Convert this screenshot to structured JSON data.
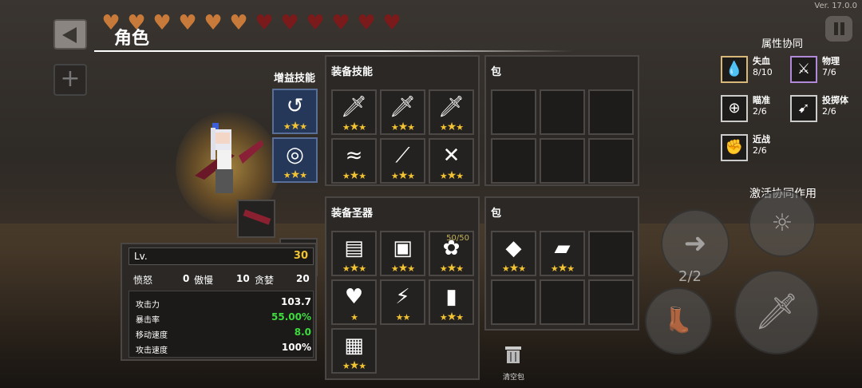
{
  "version": "Ver. 17.0.0",
  "title": "角色",
  "hearts": {
    "full": 6,
    "empty": 6
  },
  "colors": {
    "star": "#f1c232",
    "green": "#3ddc3d",
    "gold_lv": "#f1c232",
    "heart_full": "#c87a3a",
    "heart_empty": "#7a1a1a"
  },
  "buff_skills": {
    "label": "增益技能",
    "items": [
      {
        "icon": "swirl-icon",
        "glyph": "↺",
        "stars": 3
      },
      {
        "icon": "vortex-orb-icon",
        "glyph": "◎",
        "stars": 3
      }
    ]
  },
  "equip_skills": {
    "label": "装备技能",
    "items": [
      {
        "icon": "sword-slash-icon",
        "glyph": "🗡",
        "stars": 3
      },
      {
        "icon": "sword-slash-icon",
        "glyph": "🗡",
        "stars": 3
      },
      {
        "icon": "sword-slash-icon",
        "glyph": "🗡",
        "stars": 3
      },
      {
        "icon": "whirlwind-icon",
        "glyph": "≈",
        "stars": 3
      },
      {
        "icon": "feather-slash-icon",
        "glyph": "⟋",
        "stars": 3
      },
      {
        "icon": "cross-slash-icon",
        "glyph": "✕",
        "stars": 3
      }
    ]
  },
  "skill_bag": {
    "label": "包"
  },
  "equip_relics": {
    "label": "装备圣器",
    "items": [
      {
        "icon": "scroll-icon",
        "glyph": "▤",
        "stars": 3
      },
      {
        "icon": "gift-box-icon",
        "glyph": "▣",
        "stars": 3
      },
      {
        "icon": "green-spirit-icon",
        "glyph": "✿",
        "stars": 3,
        "count": "50/50"
      },
      {
        "icon": "demon-heart-icon",
        "glyph": "♥",
        "stars": 1
      },
      {
        "icon": "crack-icon",
        "glyph": "⚡",
        "stars": 2
      },
      {
        "icon": "tombstone-icon",
        "glyph": "▮",
        "stars": 3
      },
      {
        "icon": "stone-cube-icon",
        "glyph": "▦",
        "stars": 3
      }
    ]
  },
  "relic_bag": {
    "label": "包",
    "items": [
      {
        "icon": "amber-crystal-icon",
        "glyph": "◆",
        "stars": 3
      },
      {
        "icon": "purple-rune-icon",
        "glyph": "▰",
        "stars": 3
      }
    ]
  },
  "synergy": {
    "label": "属性协同",
    "items": [
      {
        "icon": "blood-drop-icon",
        "glyph": "💧",
        "name": "失血",
        "value": "8/10"
      },
      {
        "icon": "sword-icon",
        "glyph": "⚔",
        "name": "物理",
        "value": "7/6"
      },
      {
        "icon": "crosshair-icon",
        "glyph": "⊕",
        "name": "瞄准",
        "value": "2/6"
      },
      {
        "icon": "throw-icon",
        "glyph": "➹",
        "name": "投掷体",
        "value": "2/6"
      },
      {
        "icon": "fist-icon",
        "glyph": "✊",
        "name": "近战",
        "value": "2/6"
      }
    ],
    "activate_label": "激活协同作用"
  },
  "stats": {
    "lv_label": "Lv.",
    "lv_value": "30",
    "row2": [
      {
        "label": "愤怒",
        "value": "0"
      },
      {
        "label": "傲慢",
        "value": "10"
      },
      {
        "label": "贪婪",
        "value": "20"
      }
    ],
    "details": [
      {
        "label": "攻击力",
        "value": "103.7",
        "color": "#ffffff"
      },
      {
        "label": "暴击率",
        "value": "55.00%",
        "color": "#3ddc3d"
      },
      {
        "label": "移动速度",
        "value": "8.0",
        "color": "#3ddc3d"
      },
      {
        "label": "攻击速度",
        "value": "100%",
        "color": "#ffffff"
      }
    ]
  },
  "dash_counter": "2/2",
  "clear_bag_label": "清空包"
}
